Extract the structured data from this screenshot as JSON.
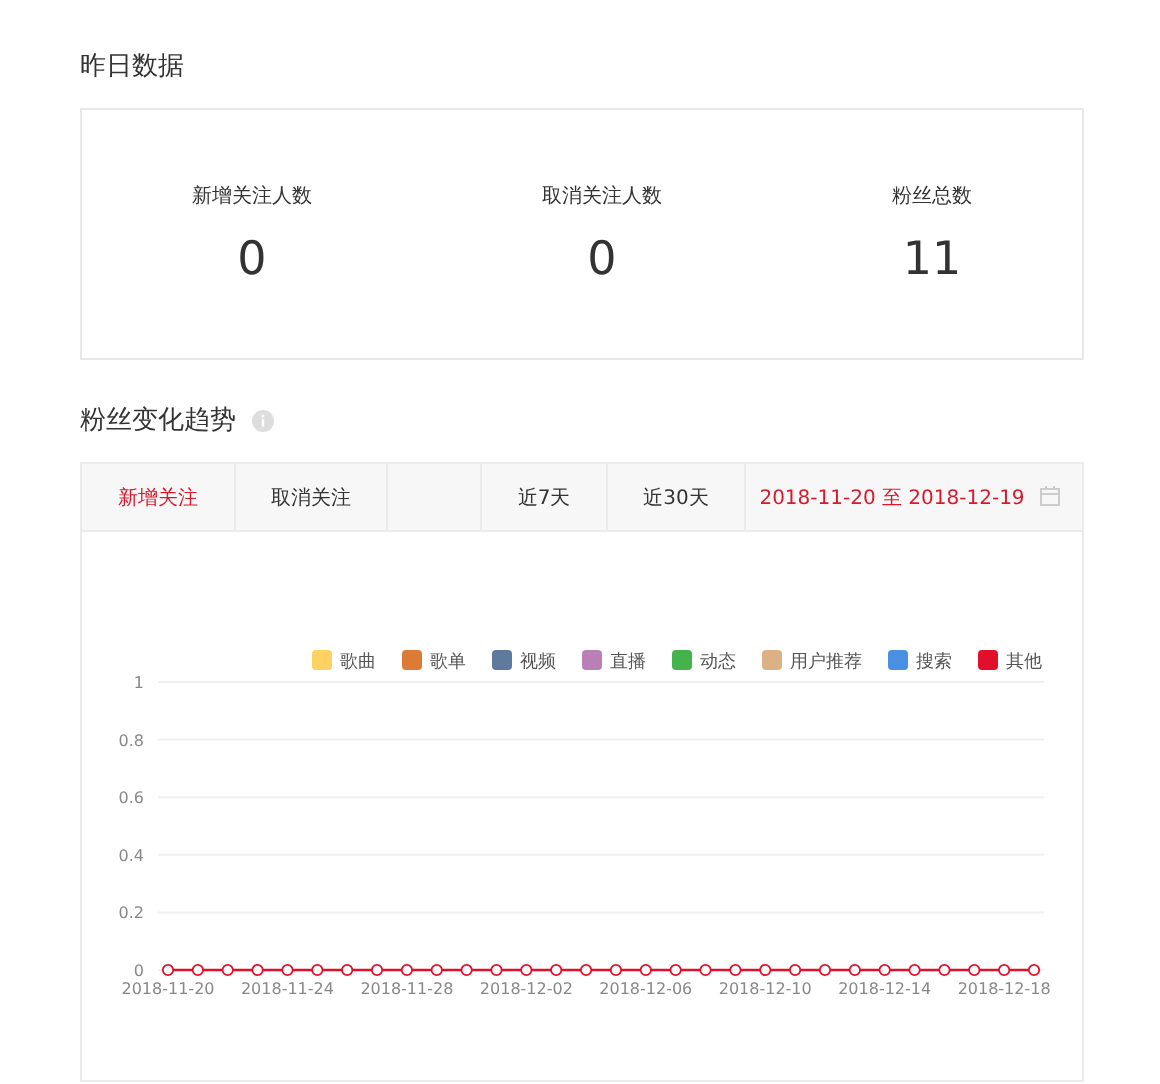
{
  "yesterday": {
    "title": "昨日数据",
    "stats": [
      {
        "label": "新增关注人数",
        "value": "0"
      },
      {
        "label": "取消关注人数",
        "value": "0"
      },
      {
        "label": "粉丝总数",
        "value": "11"
      }
    ]
  },
  "trend": {
    "title": "粉丝变化趋势",
    "metric_tabs": [
      {
        "label": "新增关注",
        "selected": true
      },
      {
        "label": "取消关注",
        "selected": false
      }
    ],
    "period_tabs": [
      {
        "label": "近7天",
        "selected": false
      },
      {
        "label": "近30天",
        "selected": false
      },
      {
        "label": "2018-11-20 至 2018-12-19",
        "selected": true
      }
    ],
    "chart_data": {
      "type": "line",
      "grid": true,
      "legend": "top",
      "categories": [
        "2018-11-20",
        null,
        null,
        null,
        "2018-11-24",
        null,
        null,
        null,
        "2018-11-28",
        null,
        null,
        null,
        "2018-12-02",
        null,
        null,
        null,
        "2018-12-06",
        null,
        null,
        null,
        "2018-12-10",
        null,
        null,
        null,
        "2018-12-14",
        null,
        null,
        null,
        "2018-12-18",
        null
      ],
      "ylim": [
        0,
        1
      ],
      "yticks": [
        0,
        0.2,
        0.4,
        0.6,
        0.8,
        1
      ],
      "series": [
        {
          "name": "歌曲",
          "color": "#fdd162",
          "values": [
            null,
            null,
            null,
            null,
            null,
            null,
            null,
            null,
            null,
            null,
            null,
            null,
            null,
            null,
            null,
            null,
            null,
            null,
            null,
            null,
            null,
            null,
            null,
            null,
            null,
            null,
            null,
            null,
            null,
            null
          ]
        },
        {
          "name": "歌单",
          "color": "#dd7a35",
          "values": [
            null,
            null,
            null,
            null,
            null,
            null,
            null,
            null,
            null,
            null,
            null,
            null,
            null,
            null,
            null,
            null,
            null,
            null,
            null,
            null,
            null,
            null,
            null,
            null,
            null,
            null,
            null,
            null,
            null,
            null
          ]
        },
        {
          "name": "视频",
          "color": "#5f7a9c",
          "values": [
            null,
            null,
            null,
            null,
            null,
            null,
            null,
            null,
            null,
            null,
            null,
            null,
            null,
            null,
            null,
            null,
            null,
            null,
            null,
            null,
            null,
            null,
            null,
            null,
            null,
            null,
            null,
            null,
            null,
            null
          ]
        },
        {
          "name": "直播",
          "color": "#b97fb6",
          "values": [
            null,
            null,
            null,
            null,
            null,
            null,
            null,
            null,
            null,
            null,
            null,
            null,
            null,
            null,
            null,
            null,
            null,
            null,
            null,
            null,
            null,
            null,
            null,
            null,
            null,
            null,
            null,
            null,
            null,
            null
          ]
        },
        {
          "name": "动态",
          "color": "#45b34c",
          "values": [
            null,
            null,
            null,
            null,
            null,
            null,
            null,
            null,
            null,
            null,
            null,
            null,
            null,
            null,
            null,
            null,
            null,
            null,
            null,
            null,
            null,
            null,
            null,
            null,
            null,
            null,
            null,
            null,
            null,
            null
          ]
        },
        {
          "name": "用户推荐",
          "color": "#dcb186",
          "values": [
            null,
            null,
            null,
            null,
            null,
            null,
            null,
            null,
            null,
            null,
            null,
            null,
            null,
            null,
            null,
            null,
            null,
            null,
            null,
            null,
            null,
            null,
            null,
            null,
            null,
            null,
            null,
            null,
            null,
            null
          ]
        },
        {
          "name": "搜索",
          "color": "#4a90e2",
          "values": [
            null,
            null,
            null,
            null,
            null,
            null,
            null,
            null,
            null,
            null,
            null,
            null,
            null,
            null,
            null,
            null,
            null,
            null,
            null,
            null,
            null,
            null,
            null,
            null,
            null,
            null,
            null,
            null,
            null,
            null
          ]
        },
        {
          "name": "其他",
          "color": "#e0102a",
          "marker": true,
          "values": [
            0,
            0,
            0,
            0,
            0,
            0,
            0,
            0,
            0,
            0,
            0,
            0,
            0,
            0,
            0,
            0,
            0,
            0,
            0,
            0,
            0,
            0,
            0,
            0,
            0,
            0,
            0,
            0,
            0,
            0
          ]
        }
      ]
    }
  }
}
